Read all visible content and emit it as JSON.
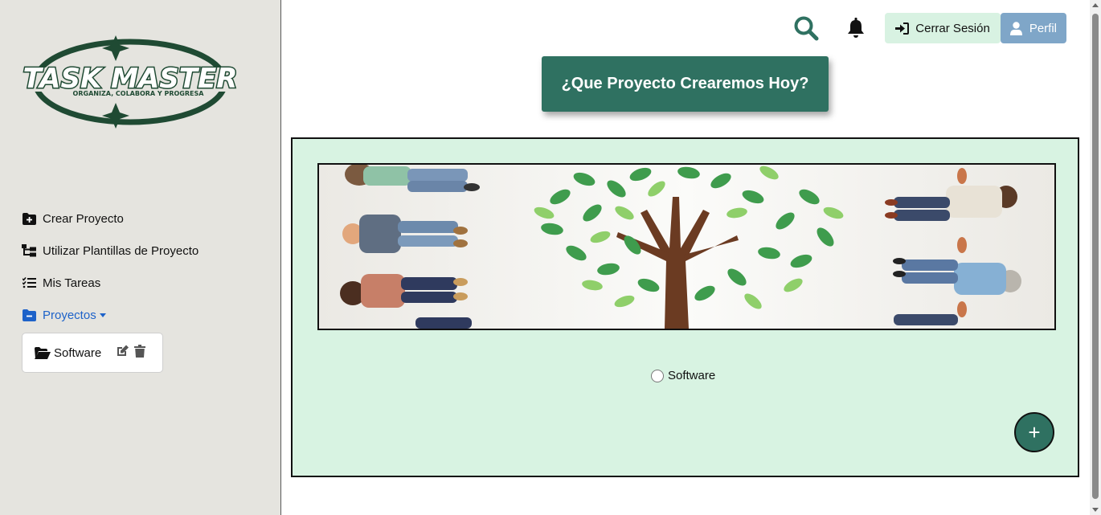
{
  "brand": {
    "logo_text": "TASK MASTER",
    "logo_tagline": "ORGANIZA, COLABORA Y PROGRESA"
  },
  "sidebar": {
    "items": [
      {
        "label": "Crear Proyecto",
        "icon": "folder-plus-icon"
      },
      {
        "label": "Utilizar Plantillas de Proyecto",
        "icon": "sitemap-icon"
      },
      {
        "label": "Mis Tareas",
        "icon": "list-check-icon"
      },
      {
        "label": "Proyectos",
        "icon": "folder-minus-icon"
      }
    ],
    "projects": [
      {
        "name": "Software"
      }
    ]
  },
  "header": {
    "logout_label": "Cerrar Sesión",
    "profile_label": "Perfil"
  },
  "main": {
    "title": "¿Que Proyecto Crearemos Hoy?",
    "project_options": [
      {
        "label": "Software",
        "selected": false
      }
    ],
    "add_label": "+"
  },
  "colors": {
    "accent": "#2f7161",
    "sidebar_bg": "#e5e4df",
    "panel_bg": "#d8f3e2",
    "active_link": "#1d62c9",
    "profile_btn": "#7fa6c8",
    "logout_btn": "#d8f2e2"
  }
}
